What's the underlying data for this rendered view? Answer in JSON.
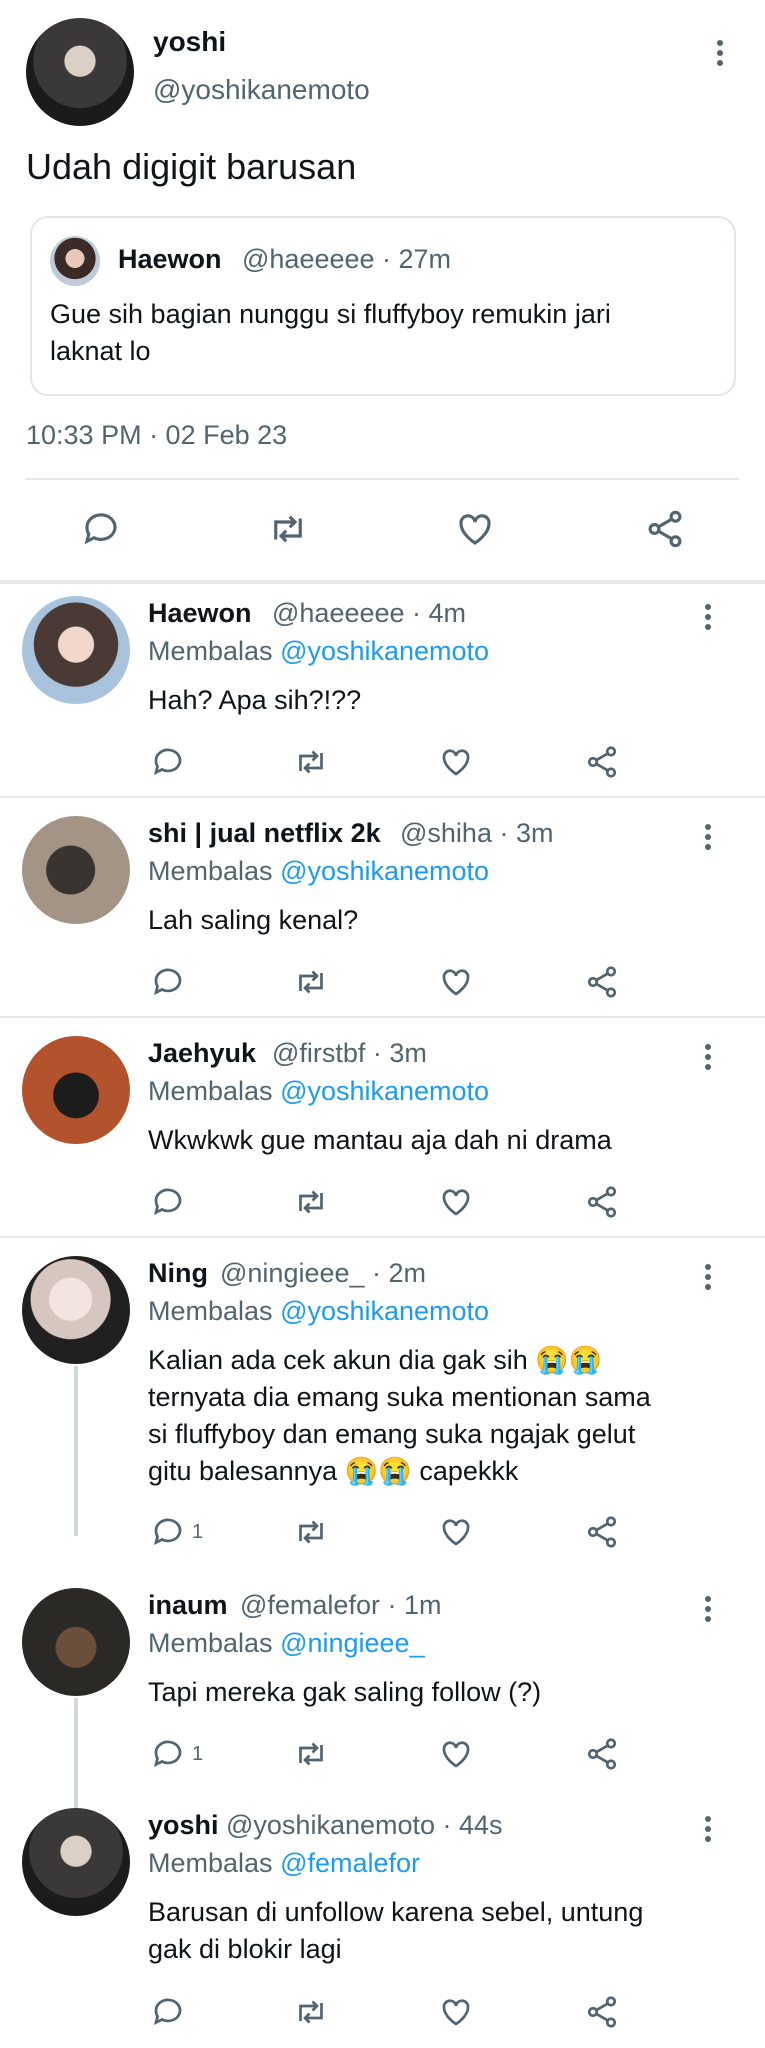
{
  "main_tweet": {
    "name": "yoshi",
    "handle": "@yoshikanemoto",
    "text": "Udah digigit barusan",
    "timestamp": "10:33 PM · 02 Feb 23",
    "quote": {
      "name": "Haewon",
      "handle_time": "@haeeeee · 27m",
      "text": "Gue sih bagian nunggu si fluffyboy remukin jari laknat lo"
    }
  },
  "replies": [
    {
      "name": "Haewon",
      "handle_time": "@haeeeee · 4m",
      "reply_prefix": "Membalas",
      "reply_to": "@yoshikanemoto",
      "text": "Hah? Apa sih?!??",
      "reply_count": ""
    },
    {
      "name": "shi | jual netflix 2k",
      "handle_time": "@shiha · 3m",
      "reply_prefix": "Membalas",
      "reply_to": "@yoshikanemoto",
      "text": "Lah saling kenal?",
      "reply_count": ""
    },
    {
      "name": "Jaehyuk",
      "handle_time": "@firstbf · 3m",
      "reply_prefix": "Membalas",
      "reply_to": "@yoshikanemoto",
      "text": "Wkwkwk gue mantau aja dah ni drama",
      "reply_count": ""
    },
    {
      "name": "Ning",
      "handle_time": "@ningieee_ · 2m",
      "reply_prefix": "Membalas",
      "reply_to": "@yoshikanemoto",
      "text_line1": "Kalian ada cek akun dia gak sih 😭😭",
      "text_line2": "ternyata dia emang suka mentionan sama",
      "text_line3": "si fluffyboy dan emang suka ngajak gelut",
      "text_line4": "gitu balesannya 😭😭 capekkk",
      "reply_count": "1"
    },
    {
      "name": "inaum",
      "handle_time": "@femalefor · 1m",
      "reply_prefix": "Membalas",
      "reply_to": "@ningieee_",
      "text": "Tapi mereka gak saling follow (?)",
      "reply_count": "1"
    },
    {
      "name": "yoshi",
      "handle_time": "@yoshikanemoto · 44s",
      "reply_prefix": "Membalas",
      "reply_to": "@femalefor",
      "text_line1": "Barusan di unfollow karena sebel, untung",
      "text_line2": "gak di blokir lagi",
      "reply_count": ""
    }
  ],
  "colors": {
    "link": "#1d9bf0",
    "muted": "#536471",
    "text": "#0f1419",
    "divider": "#e6e9eb"
  }
}
